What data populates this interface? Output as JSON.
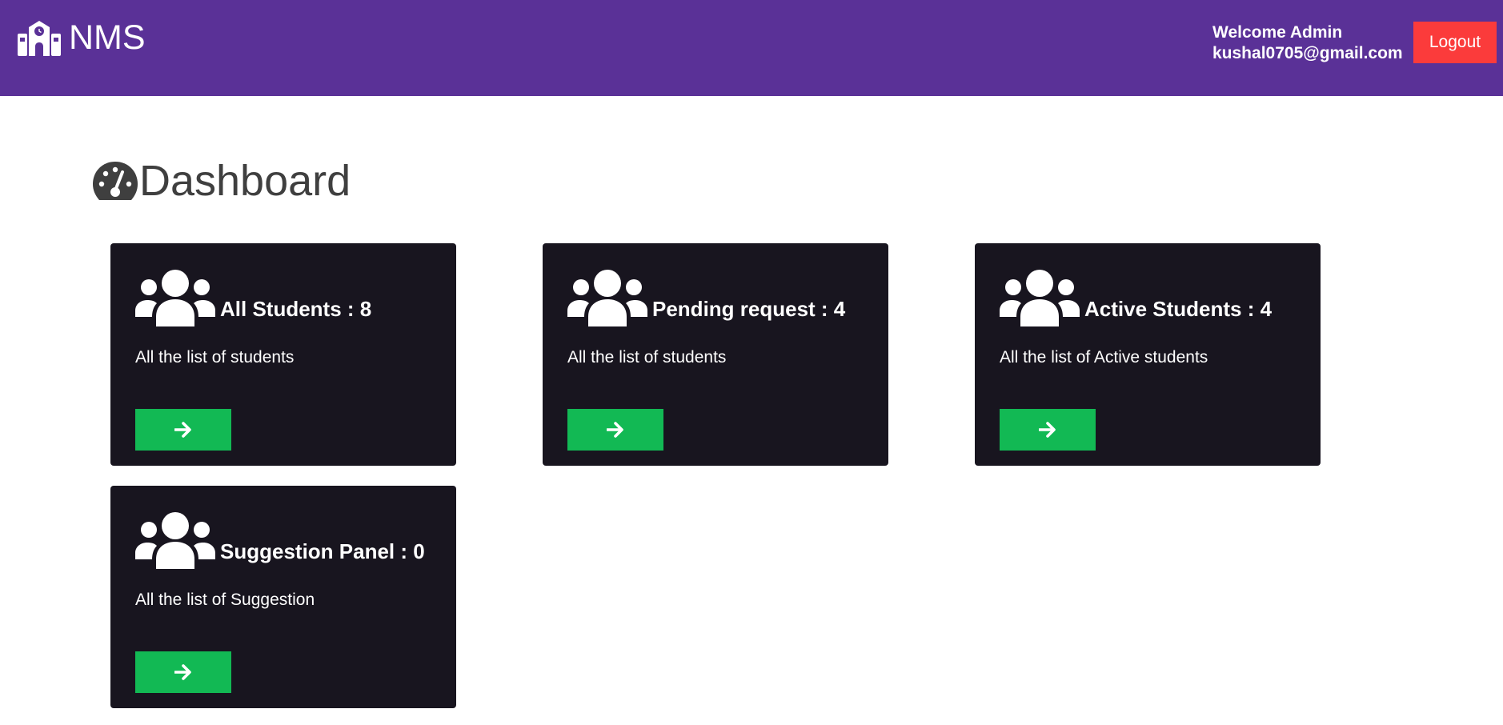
{
  "header": {
    "brand_name": "NMS",
    "welcome_text": "Welcome Admin",
    "user_email": "kushal0705@gmail.com",
    "logout_label": "Logout",
    "colors": {
      "navbar": "#5a3197",
      "logout": "#fb3b3b"
    }
  },
  "page": {
    "title": "Dashboard"
  },
  "cards": [
    {
      "title": "All Students : 8",
      "description": "All the list of students",
      "icon": "users-icon",
      "button_icon": "arrow-right-icon"
    },
    {
      "title": "Pending request : 4",
      "description": "All the list of students",
      "icon": "users-icon",
      "button_icon": "arrow-right-icon"
    },
    {
      "title": "Active Students : 4",
      "description": "All the list of Active students",
      "icon": "users-icon",
      "button_icon": "arrow-right-icon"
    },
    {
      "title": "Suggestion Panel : 0",
      "description": "All the list of Suggestion",
      "icon": "users-icon",
      "button_icon": "arrow-right-icon"
    }
  ],
  "colors": {
    "card_background": "#18151f",
    "card_button": "#12b954",
    "title_text": "#3f3f3f"
  }
}
